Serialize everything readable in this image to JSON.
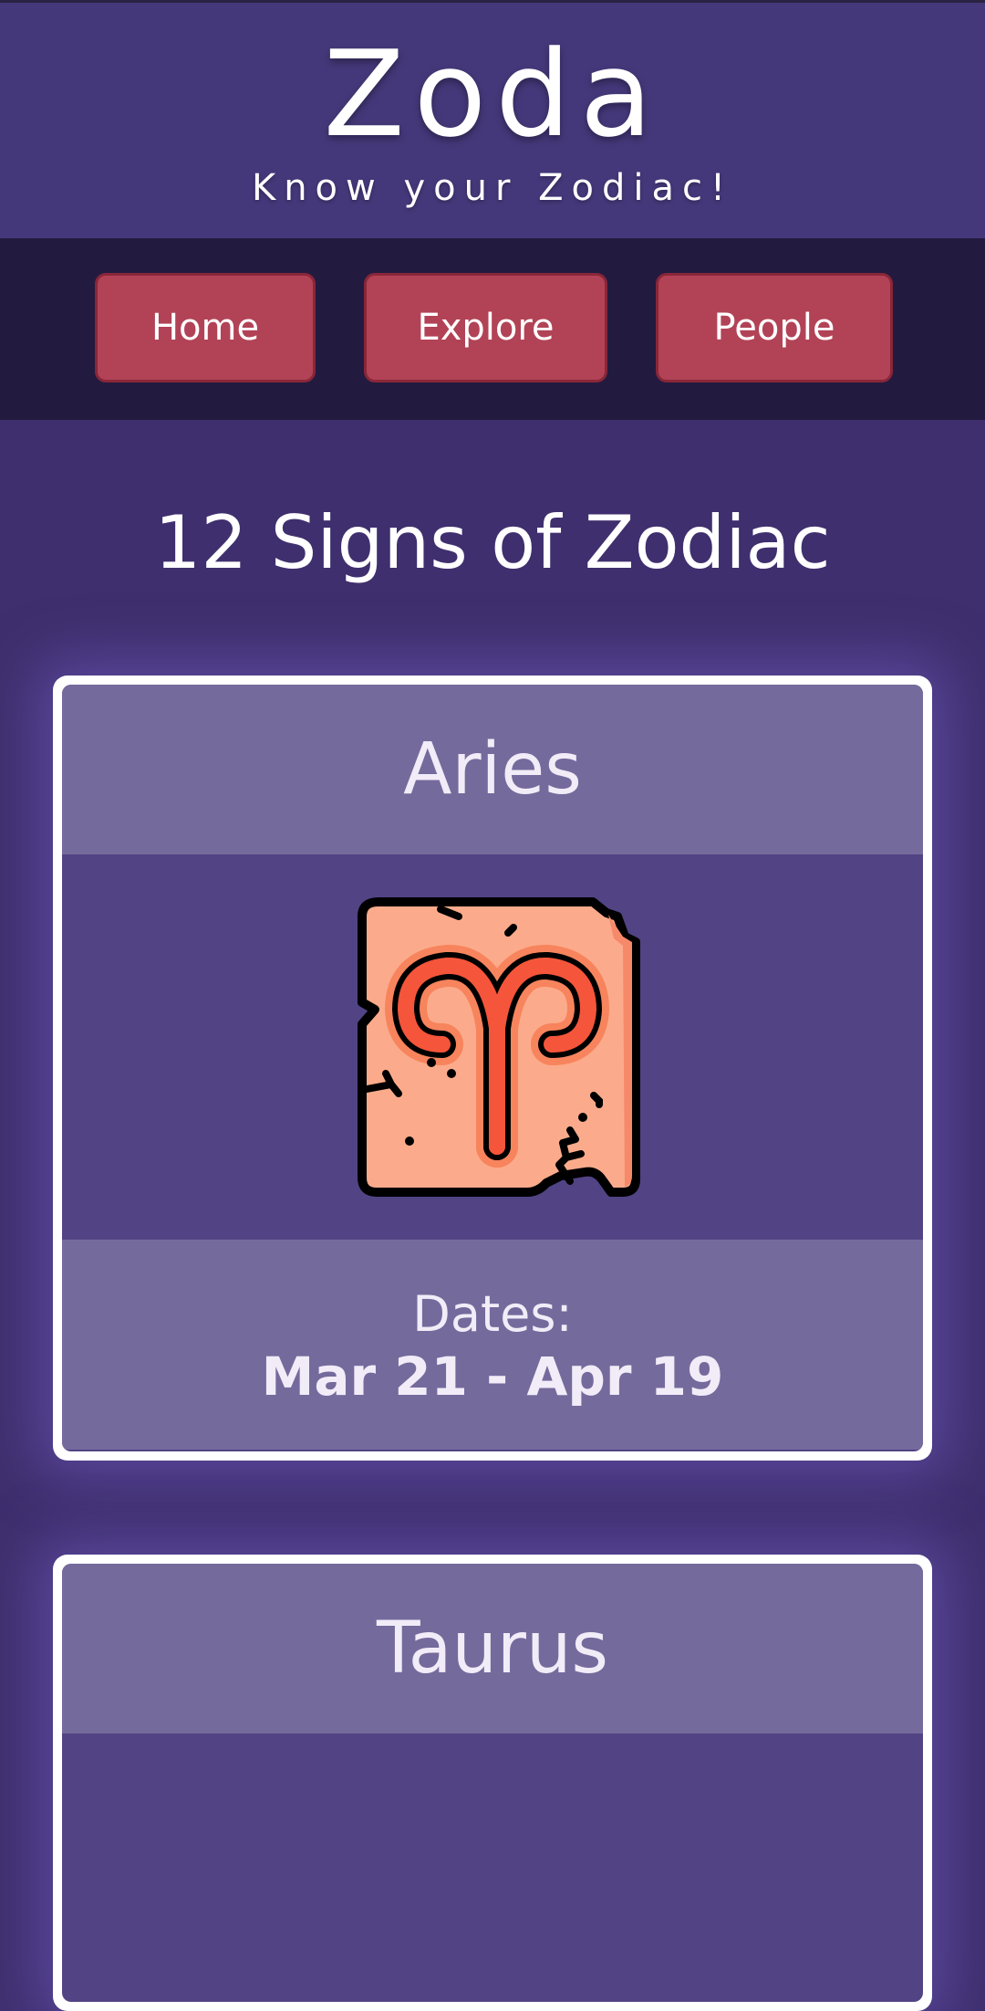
{
  "header": {
    "brand": "Zoda",
    "tagline": "Know your Zodiac!"
  },
  "nav": {
    "home": "Home",
    "explore": "Explore",
    "people": "People"
  },
  "main": {
    "title": "12 Signs of Zodiac",
    "signs": [
      {
        "name": "Aries",
        "icon": "aries-icon",
        "dates_label": "Dates:",
        "dates": "Mar 21 - Apr 19"
      },
      {
        "name": "Taurus"
      }
    ]
  },
  "colors": {
    "header_bg": "#45387a",
    "nav_bg": "#221b3f",
    "nav_button": "#b24356",
    "page_bg": "#3f2f6e",
    "card_band": "#756a9c",
    "card_body": "#524384"
  }
}
